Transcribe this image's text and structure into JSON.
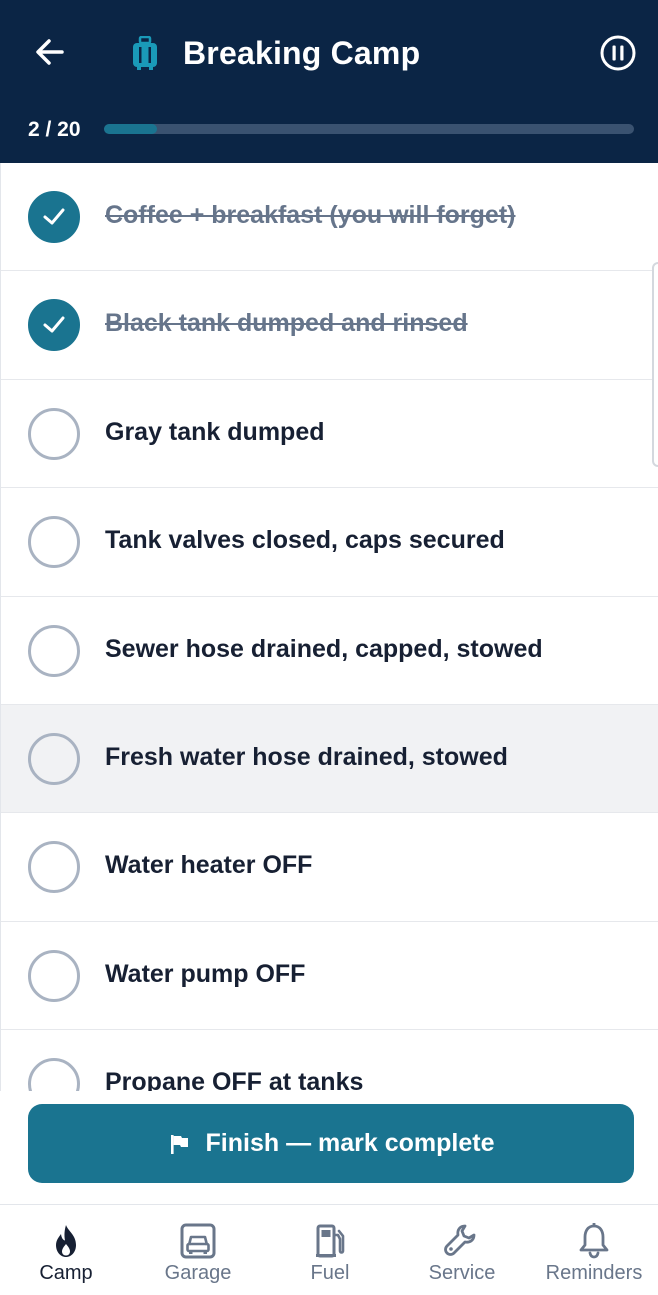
{
  "header": {
    "title": "Breaking Camp",
    "progress_text": "2 / 20",
    "progress_fraction": 0.1
  },
  "checklist": {
    "items": [
      {
        "label": "Coffee + breakfast (you will forget)",
        "checked": true
      },
      {
        "label": "Black tank dumped and rinsed",
        "checked": true
      },
      {
        "label": "Gray tank dumped",
        "checked": false
      },
      {
        "label": "Tank valves closed, caps secured",
        "checked": false
      },
      {
        "label": "Sewer hose drained, capped, stowed",
        "checked": false
      },
      {
        "label": "Fresh water hose drained, stowed",
        "checked": false
      },
      {
        "label": "Water heater OFF",
        "checked": false
      },
      {
        "label": "Water pump OFF",
        "checked": false
      },
      {
        "label": "Propane OFF at tanks",
        "checked": false
      }
    ]
  },
  "finish": {
    "label": "Finish — mark complete"
  },
  "nav": {
    "items": [
      {
        "label": "Camp",
        "icon": "flame-icon",
        "active": true
      },
      {
        "label": "Garage",
        "icon": "car-icon",
        "active": false
      },
      {
        "label": "Fuel",
        "icon": "fuel-pump-icon",
        "active": false
      },
      {
        "label": "Service",
        "icon": "wrench-icon",
        "active": false
      },
      {
        "label": "Reminders",
        "icon": "bell-icon",
        "active": false
      }
    ]
  },
  "colors": {
    "header_bg": "#0b2545",
    "accent": "#1a7490",
    "text": "#172033",
    "muted": "#69768a"
  }
}
